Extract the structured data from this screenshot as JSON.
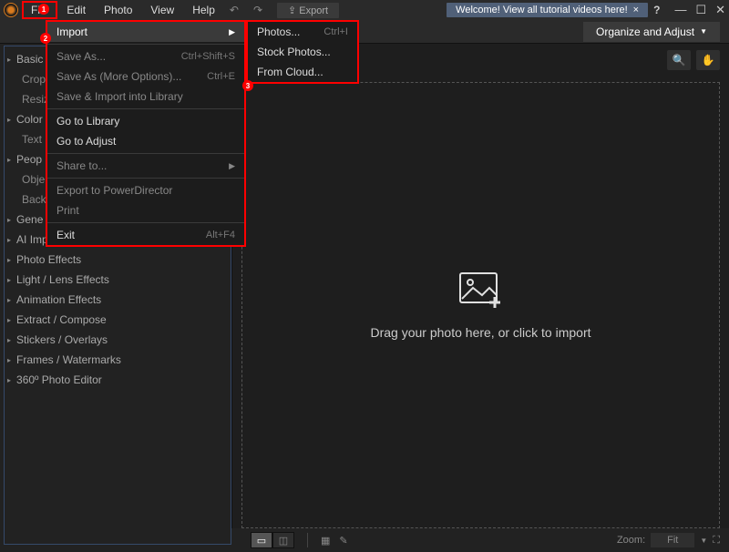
{
  "menubar": {
    "items": [
      "File",
      "Edit",
      "Photo",
      "View",
      "Help"
    ]
  },
  "export_label": "Export",
  "welcome_banner": "Welcome! View all tutorial videos here!",
  "mode_button": "Organize and Adjust",
  "sidebar": {
    "groups": [
      {
        "label": "Basic",
        "children": [
          "Crop",
          "Resiz"
        ]
      },
      {
        "label": "Color",
        "children": [
          "Text"
        ]
      },
      {
        "label": "Peop",
        "children": [
          "Obje",
          "Back"
        ]
      },
      {
        "label": "Gene",
        "children": []
      },
      {
        "label": "AI Improvements",
        "children": []
      },
      {
        "label": "Photo Effects",
        "children": []
      },
      {
        "label": "Light / Lens Effects",
        "children": []
      },
      {
        "label": "Animation Effects",
        "children": []
      },
      {
        "label": "Extract / Compose",
        "children": []
      },
      {
        "label": "Stickers / Overlays",
        "children": []
      },
      {
        "label": "Frames / Watermarks",
        "children": []
      },
      {
        "label": "360º Photo Editor",
        "children": []
      }
    ]
  },
  "drop_text": "Drag your photo here, or click to import",
  "zoom": {
    "label": "Zoom:",
    "value": "Fit"
  },
  "file_menu": {
    "items": [
      {
        "label": "Import",
        "shortcut": "",
        "arrow": true,
        "enabled": true,
        "highlight": true
      },
      {
        "sep": true
      },
      {
        "label": "Save As...",
        "shortcut": "Ctrl+Shift+S",
        "enabled": false
      },
      {
        "label": "Save As (More Options)...",
        "shortcut": "Ctrl+E",
        "enabled": false
      },
      {
        "label": "Save & Import into Library",
        "shortcut": "",
        "enabled": false
      },
      {
        "sep": true
      },
      {
        "label": "Go to Library",
        "shortcut": "",
        "enabled": true
      },
      {
        "label": "Go to Adjust",
        "shortcut": "",
        "enabled": true
      },
      {
        "sep": true
      },
      {
        "label": "Share to...",
        "shortcut": "",
        "arrow": true,
        "enabled": false
      },
      {
        "sep": true
      },
      {
        "label": "Export to PowerDirector",
        "shortcut": "",
        "enabled": false
      },
      {
        "label": "Print",
        "shortcut": "",
        "enabled": false
      },
      {
        "sep": true
      },
      {
        "label": "Exit",
        "shortcut": "Alt+F4",
        "enabled": true
      }
    ]
  },
  "import_submenu": {
    "items": [
      {
        "label": "Photos...",
        "shortcut": "Ctrl+I"
      },
      {
        "label": "Stock Photos..."
      },
      {
        "label": "From Cloud..."
      }
    ]
  },
  "badges": {
    "b1": "1",
    "b2": "2",
    "b3": "3"
  }
}
